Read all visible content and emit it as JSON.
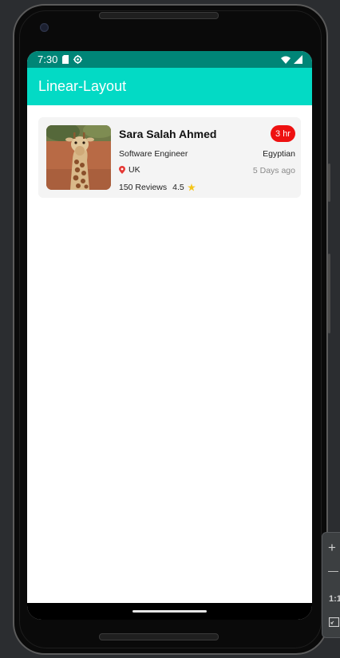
{
  "status_bar": {
    "time": "7:30",
    "icons": [
      "sim-card-icon",
      "settings-gear-icon",
      "wifi-icon",
      "cell-signal-icon"
    ],
    "color": "#008577"
  },
  "app_bar": {
    "title": "Linear-Layout",
    "color": "#03dac5"
  },
  "card": {
    "name": "Sara Salah Ahmed",
    "badge": "3 hr",
    "role": "Software Engineer",
    "nationality": "Egyptian",
    "location": "UK",
    "posted": "5 Days ago",
    "reviews": "150 Reviews",
    "rating": "4.5",
    "badge_color": "#ee1111",
    "pin_color": "#e53935",
    "star_color": "#f5c518"
  },
  "emulator_toolbar": {
    "zoom_in": "+",
    "zoom_out": "—",
    "ratio": "1:1"
  }
}
